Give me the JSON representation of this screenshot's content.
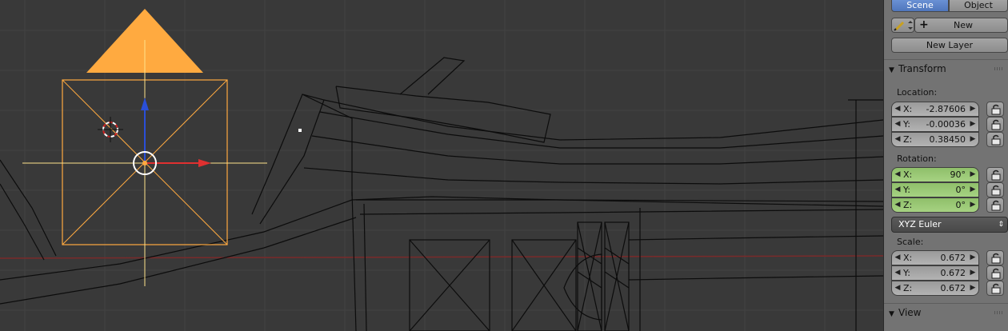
{
  "tabs": {
    "scene": "Scene",
    "object": "Object"
  },
  "toolbar": {
    "new_label": "New",
    "new_layer_label": "New Layer"
  },
  "transform": {
    "header": "Transform",
    "location_label": "Location:",
    "location": [
      {
        "axis": "X:",
        "value": "-2.87606"
      },
      {
        "axis": "Y:",
        "value": "-0.00036"
      },
      {
        "axis": "Z:",
        "value": "0.38450"
      }
    ],
    "rotation_label": "Rotation:",
    "rotation": [
      {
        "axis": "X:",
        "value": "90°"
      },
      {
        "axis": "Y:",
        "value": "0°"
      },
      {
        "axis": "Z:",
        "value": "0°"
      }
    ],
    "rotation_mode": "XYZ Euler",
    "scale_label": "Scale:",
    "scale": [
      {
        "axis": "X:",
        "value": "0.672"
      },
      {
        "axis": "Y:",
        "value": "0.672"
      },
      {
        "axis": "Z:",
        "value": "0.672"
      }
    ]
  },
  "view": {
    "header": "View"
  },
  "colors": {
    "viewport_bg": "#393939",
    "selection": "#ffaa40",
    "active_tab": "#5680c2",
    "rotation_field": "#9bc878",
    "x_axis": "#e03030",
    "z_axis": "#2a4fd8"
  },
  "icons": [
    "grease-pencil-icon",
    "plus-icon",
    "lock-icon",
    "crosshair-cursor-icon",
    "camera-triangle-icon"
  ]
}
